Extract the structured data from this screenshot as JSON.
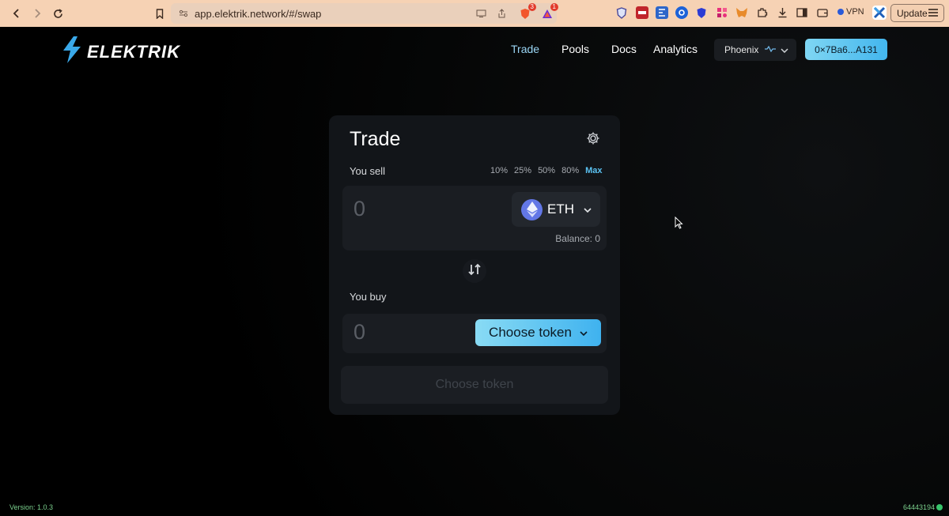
{
  "browser": {
    "url": "app.elektrik.network/#/swap",
    "shield_badge": "3",
    "alert_badge": "1",
    "vpn_label": "VPN",
    "update_label": "Update"
  },
  "header": {
    "brand": "ELEKTRIK",
    "nav": [
      "Trade",
      "Pools",
      "Docs",
      "Analytics"
    ],
    "active_nav": "Trade",
    "network": "Phoenix",
    "wallet": "0×7Ba6...A131"
  },
  "trade": {
    "title": "Trade",
    "sell_label": "You sell",
    "percentages": [
      "10%",
      "25%",
      "50%",
      "80%"
    ],
    "max_label": "Max",
    "sell_amount": "0",
    "sell_token": "ETH",
    "balance": "Balance: 0",
    "buy_label": "You buy",
    "buy_amount": "0",
    "choose_token": "Choose token",
    "submit_label": "Choose token"
  },
  "footer": {
    "version": "Version: 1.0.3",
    "block": "64443194"
  },
  "colors": {
    "accent": "#43b6ee",
    "chrome": "#f6d2b4",
    "card": "#121519"
  }
}
